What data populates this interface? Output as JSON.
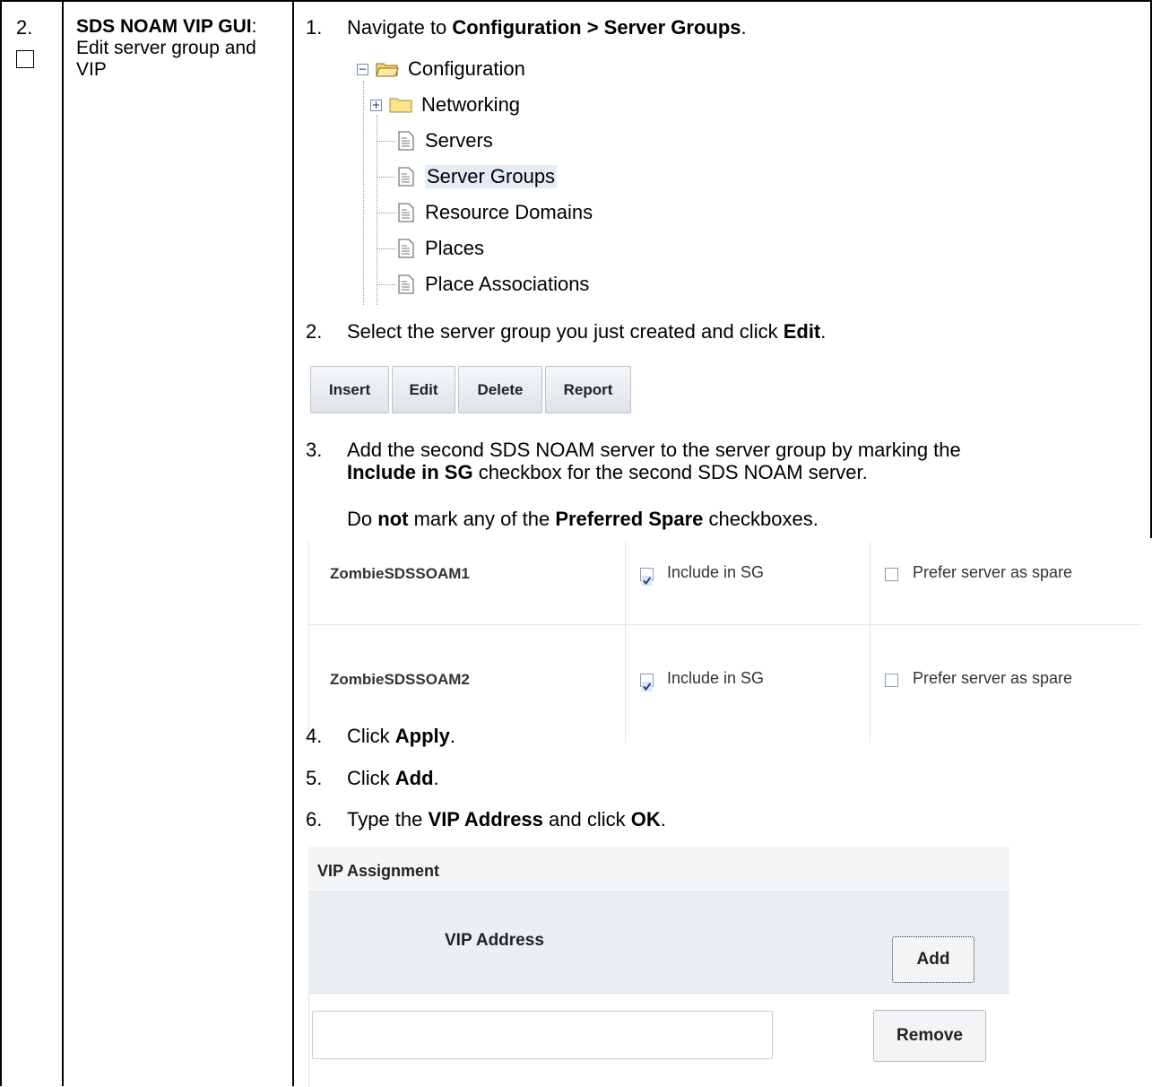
{
  "step": {
    "number": "2.",
    "title_bold": "SDS NOAM VIP GUI",
    "title_rest": ": Edit server group and VIP"
  },
  "instructions": [
    {
      "num": "1.",
      "pre": "Navigate to ",
      "bold": "Configuration > Server Groups",
      "post": "."
    },
    {
      "num": "2.",
      "pre": "Select the server group you just created and click ",
      "bold": "Edit",
      "post": "."
    },
    {
      "num": "3.",
      "line1": "Add the second SDS NOAM server to the server group by marking the",
      "line2_bold": "Include in SG",
      "line2_rest": " checkbox for the second SDS NOAM server."
    },
    {
      "num": "4.",
      "pre": "Click ",
      "bold": "Apply",
      "post": "."
    },
    {
      "num": "5.",
      "pre": "Click ",
      "bold": "Add",
      "post": "."
    },
    {
      "num": "6.",
      "pre": "Type the ",
      "bold": "VIP Address",
      "mid": " and click ",
      "bold2": "OK",
      "post": "."
    }
  ],
  "note": {
    "pre": "Do ",
    "bold1": "not",
    "mid": " mark any of the ",
    "bold2": "Preferred Spare",
    "post": " checkboxes."
  },
  "tree": {
    "root": "Configuration",
    "items": [
      "Networking",
      "Servers",
      "Server Groups",
      "Resource Domains",
      "Places",
      "Place Associations"
    ]
  },
  "toolbar": {
    "insert": "Insert",
    "edit": "Edit",
    "delete": "Delete",
    "report": "Report"
  },
  "server_group": {
    "rows": [
      {
        "name": "ZombieSDSSOAM1",
        "include": "Include in SG",
        "include_checked": true,
        "spare": "Prefer server as spare",
        "spare_checked": false
      },
      {
        "name": "ZombieSDSSOAM2",
        "include": "Include in SG",
        "include_checked": true,
        "spare": "Prefer server as spare",
        "spare_checked": false
      }
    ]
  },
  "vip": {
    "header": "VIP Assignment",
    "column": "VIP Address",
    "add": "Add",
    "remove": "Remove",
    "input_value": ""
  }
}
